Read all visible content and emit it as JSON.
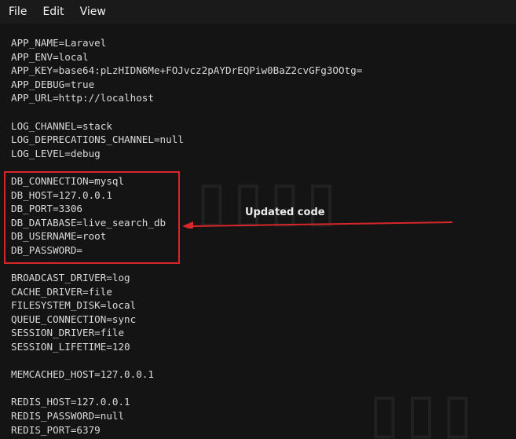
{
  "menu": {
    "items": [
      "File",
      "Edit",
      "View"
    ]
  },
  "editor": {
    "lines": [
      "APP_NAME=Laravel",
      "APP_ENV=local",
      "APP_KEY=base64:pLzHIDN6Me+FOJvcz2pAYDrEQPiw0BaZ2cvGFg3OOtg=",
      "APP_DEBUG=true",
      "APP_URL=http://localhost",
      "",
      "LOG_CHANNEL=stack",
      "LOG_DEPRECATIONS_CHANNEL=null",
      "LOG_LEVEL=debug",
      "",
      "DB_CONNECTION=mysql",
      "DB_HOST=127.0.0.1",
      "DB_PORT=3306",
      "DB_DATABASE=live_search_db",
      "DB_USERNAME=root",
      "DB_PASSWORD=",
      "",
      "BROADCAST_DRIVER=log",
      "CACHE_DRIVER=file",
      "FILESYSTEM_DISK=local",
      "QUEUE_CONNECTION=sync",
      "SESSION_DRIVER=file",
      "SESSION_LIFETIME=120",
      "",
      "MEMCACHED_HOST=127.0.0.1",
      "",
      "REDIS_HOST=127.0.0.1",
      "REDIS_PASSWORD=null",
      "REDIS_PORT=6379"
    ]
  },
  "annotation": {
    "text": "Updated code",
    "color": "#d8262b"
  }
}
